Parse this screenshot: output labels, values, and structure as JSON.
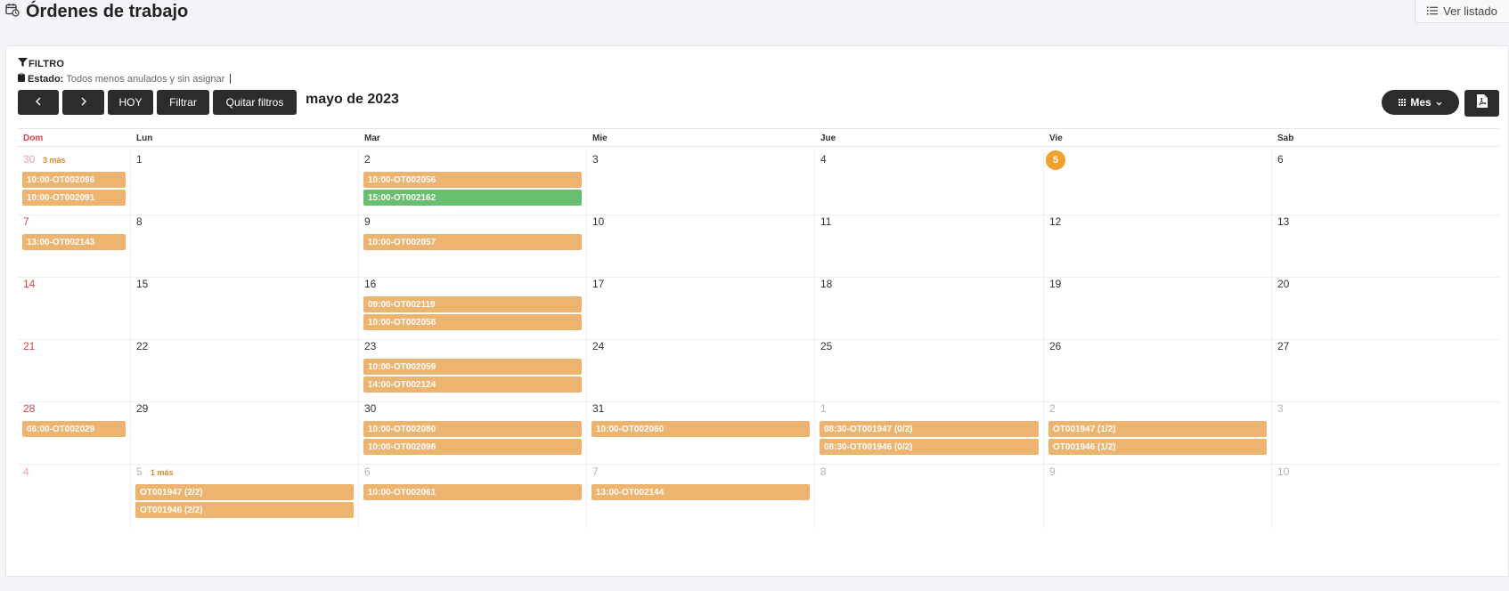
{
  "header": {
    "title": "Órdenes de trabajo",
    "list_button": "Ver listado"
  },
  "filter": {
    "title": "FILTRO",
    "state_label": "Estado:",
    "state_value": "Todos menos anulados y sin asignar"
  },
  "toolbar": {
    "prev": "‹",
    "next": "›",
    "today": "HOY",
    "filter": "Filtrar",
    "clear": "Quitar filtros",
    "month_title": "mayo de 2023",
    "view_label": "Mes"
  },
  "weekdays": [
    "Dom",
    "Lun",
    "Mar",
    "Mie",
    "Jue",
    "Vie",
    "Sab"
  ],
  "weeks": [
    {
      "days": [
        {
          "n": "30",
          "other": true,
          "more": "3 más",
          "events": [
            {
              "label": "10:00-OT002096",
              "color": "orange"
            },
            {
              "label": "10:00-OT002091",
              "color": "orange"
            }
          ]
        },
        {
          "n": "1",
          "events": []
        },
        {
          "n": "2",
          "events": [
            {
              "label": "10:00-OT002056",
              "color": "orange"
            },
            {
              "label": "15:00-OT002162",
              "color": "green"
            }
          ]
        },
        {
          "n": "3",
          "events": []
        },
        {
          "n": "4",
          "events": []
        },
        {
          "n": "5",
          "today": true,
          "events": []
        },
        {
          "n": "6",
          "events": []
        }
      ]
    },
    {
      "days": [
        {
          "n": "7",
          "events": [
            {
              "label": "13:00-OT002143",
              "color": "orange"
            }
          ]
        },
        {
          "n": "8",
          "events": []
        },
        {
          "n": "9",
          "events": [
            {
              "label": "10:00-OT002057",
              "color": "orange"
            }
          ]
        },
        {
          "n": "10",
          "events": []
        },
        {
          "n": "11",
          "events": []
        },
        {
          "n": "12",
          "events": []
        },
        {
          "n": "13",
          "events": []
        }
      ]
    },
    {
      "days": [
        {
          "n": "14",
          "events": []
        },
        {
          "n": "15",
          "events": []
        },
        {
          "n": "16",
          "events": [
            {
              "label": "09:00-OT002119",
              "color": "orange"
            },
            {
              "label": "10:00-OT002058",
              "color": "orange"
            }
          ]
        },
        {
          "n": "17",
          "events": []
        },
        {
          "n": "18",
          "events": []
        },
        {
          "n": "19",
          "events": []
        },
        {
          "n": "20",
          "events": []
        }
      ]
    },
    {
      "days": [
        {
          "n": "21",
          "events": []
        },
        {
          "n": "22",
          "events": []
        },
        {
          "n": "23",
          "events": [
            {
              "label": "10:00-OT002059",
              "color": "orange"
            },
            {
              "label": "14:00-OT002124",
              "color": "orange"
            }
          ]
        },
        {
          "n": "24",
          "events": []
        },
        {
          "n": "25",
          "events": []
        },
        {
          "n": "26",
          "events": []
        },
        {
          "n": "27",
          "events": []
        }
      ]
    },
    {
      "days": [
        {
          "n": "28",
          "events": [
            {
              "label": "06:00-OT002029",
              "color": "orange"
            }
          ]
        },
        {
          "n": "29",
          "events": []
        },
        {
          "n": "30",
          "events": [
            {
              "label": "10:00-OT002080",
              "color": "orange"
            },
            {
              "label": "10:00-OT002098",
              "color": "orange"
            }
          ]
        },
        {
          "n": "31",
          "events": [
            {
              "label": "10:00-OT002060",
              "color": "orange"
            }
          ]
        },
        {
          "n": "1",
          "other": true,
          "events": [
            {
              "label": "08:30-OT001947 (0/2)",
              "color": "orange"
            },
            {
              "label": "08:30-OT001946 (0/2)",
              "color": "orange"
            }
          ]
        },
        {
          "n": "2",
          "other": true,
          "events": [
            {
              "label": "OT001947 (1/2)",
              "color": "orange"
            },
            {
              "label": "OT001946 (1/2)",
              "color": "orange"
            }
          ]
        },
        {
          "n": "3",
          "other": true,
          "events": []
        }
      ]
    },
    {
      "days": [
        {
          "n": "4",
          "other": true,
          "events": []
        },
        {
          "n": "5",
          "other": true,
          "more": "1 más",
          "events": [
            {
              "label": "OT001947 (2/2)",
              "color": "orange"
            },
            {
              "label": "OT001946 (2/2)",
              "color": "orange"
            }
          ]
        },
        {
          "n": "6",
          "other": true,
          "events": [
            {
              "label": "10:00-OT002061",
              "color": "orange"
            }
          ]
        },
        {
          "n": "7",
          "other": true,
          "events": [
            {
              "label": "13:00-OT002144",
              "color": "orange"
            }
          ]
        },
        {
          "n": "8",
          "other": true,
          "events": []
        },
        {
          "n": "9",
          "other": true,
          "events": []
        },
        {
          "n": "10",
          "other": true,
          "events": []
        }
      ]
    }
  ],
  "colors": {
    "event_orange": "#ecb46e",
    "event_green": "#68bf6f",
    "today": "#f2a12a",
    "sunday": "#e0404a",
    "button_dark": "#2c2c2c"
  },
  "icons": {
    "title": "calendar-clock-icon",
    "list": "list-icon",
    "filter": "funnel-icon",
    "state": "clipboard-icon",
    "view": "grid-icon",
    "pdf": "pdf-file-icon"
  }
}
